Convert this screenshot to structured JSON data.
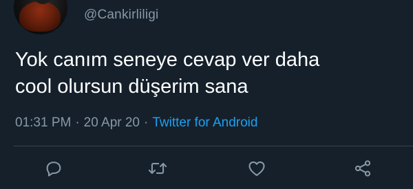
{
  "tweet": {
    "handle": "@Cankirliligi",
    "text_line1": "Yok canım seneye cevap ver daha",
    "text_line2": "cool olursun düşerim sana",
    "time": "01:31 PM",
    "date": "20 Apr 20",
    "source": "Twitter for Android",
    "separator": "·"
  },
  "actions": {
    "icons": [
      "reply-icon",
      "retweet-icon",
      "like-icon",
      "share-icon"
    ]
  },
  "colors": {
    "background": "#15202b",
    "secondary_text": "#8899a6",
    "link": "#1da1f2",
    "divider": "#38444d",
    "icon": "#8899a6"
  }
}
